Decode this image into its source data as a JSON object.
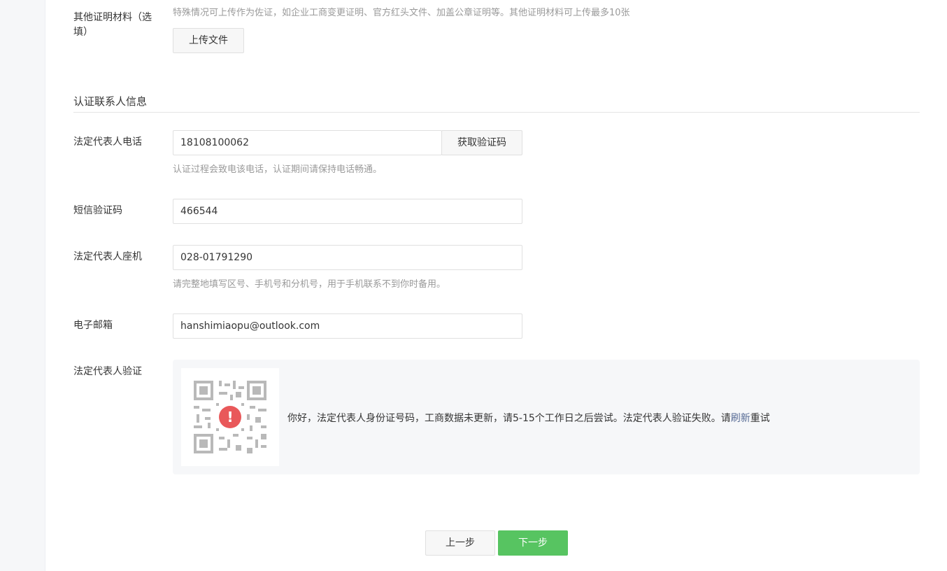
{
  "other_materials": {
    "label": "其他证明材料（选填）",
    "tip": "特殊情况可上传作为佐证，如企业工商变更证明、官方红头文件、加盖公章证明等。其他证明材料可上传最多10张",
    "upload_label": "上传文件"
  },
  "contact_section": {
    "title": "认证联系人信息"
  },
  "phone": {
    "label": "法定代表人电话",
    "value": "18108100062",
    "get_code_label": "获取验证码",
    "tip": "认证过程会致电该电话，认证期间请保持电话畅通。"
  },
  "sms_code": {
    "label": "短信验证码",
    "value": "466544"
  },
  "landline": {
    "label": "法定代表人座机",
    "value": "028-01791290",
    "tip": "请完整地填写区号、手机号和分机号，用于手机联系不到你时备用。"
  },
  "email": {
    "label": "电子邮箱",
    "value": "hanshimiaopu@outlook.com"
  },
  "verification": {
    "label": "法定代表人验证",
    "alert_glyph": "!",
    "message_prefix": "你好，法定代表人身份证号码，工商数据未更新，请5-15个工作日之后尝试。法定代表人验证失败。请",
    "refresh_link": "刷新",
    "message_suffix": "重试"
  },
  "footer": {
    "prev_label": "上一步",
    "next_label": "下一步"
  },
  "colors": {
    "primary": "#57c461",
    "link": "#576b95",
    "alert": "#e9585a"
  },
  "icons": {
    "qr": "qr-code-icon",
    "alert": "exclamation-circle-icon"
  }
}
